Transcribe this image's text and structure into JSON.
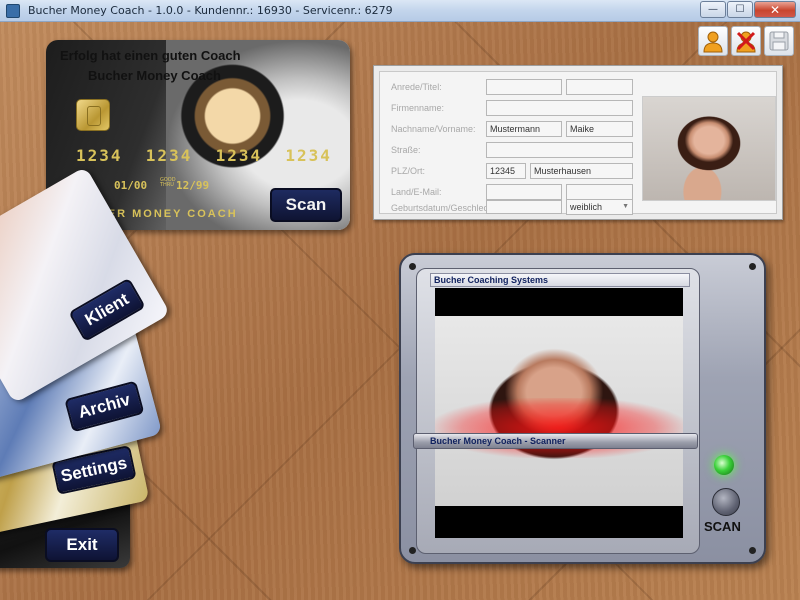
{
  "window": {
    "title": "Bucher Money Coach - 1.0.0 - Kundennr.: 16930 - Servicenr.: 6279",
    "minimize_glyph": "—",
    "maximize_glyph": "☐",
    "close_glyph": "✕"
  },
  "toolbar": {
    "user_icon": "user-icon",
    "delete_user_icon": "delete-user-icon",
    "save_icon": "save-icon"
  },
  "coach_card": {
    "line1": "Erfolg hat einen guten Coach",
    "line2": "Bucher Money Coach",
    "number": "1234  1234  1234  1234",
    "valid_from": "01/00",
    "valid_small_top": "GOOD",
    "valid_small_bottom": "THRU",
    "valid_to": "12/99",
    "brand": "BUCHER MONEY COACH",
    "scan_label": "Scan"
  },
  "side_cards": {
    "klient": "Klient",
    "archiv": "Archiv",
    "settings": "Settings",
    "exit": "Exit"
  },
  "form": {
    "labels": {
      "anrede": "Anrede/Titel:",
      "firma": "Firmenname:",
      "name": "Nachname/Vorname:",
      "strasse": "Straße:",
      "plzort": "PLZ/Ort:",
      "land": "Land/E-Mail:",
      "geburt": "Geburtsdatum/Geschlecht:"
    },
    "values": {
      "anrede": "",
      "titel": "",
      "firma": "",
      "nachname": "Mustermann",
      "vorname": "Maike",
      "strasse": "",
      "plz": "12345",
      "ort": "Musterhausen",
      "land": "",
      "email": "",
      "geburtsdatum": "",
      "geschlecht": "weiblich"
    }
  },
  "scanner": {
    "title": "Bucher Coaching Systems",
    "bar_label": "Bucher Money Coach - Scanner",
    "scan_label": "SCAN"
  }
}
